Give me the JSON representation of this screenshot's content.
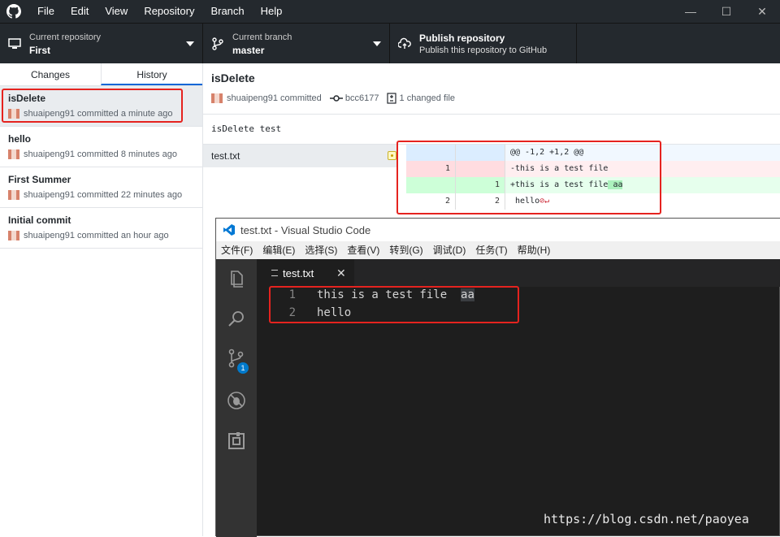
{
  "titlebar": {
    "menu": [
      "File",
      "Edit",
      "View",
      "Repository",
      "Branch",
      "Help"
    ]
  },
  "toolbar": {
    "repo": {
      "label": "Current repository",
      "value": "First"
    },
    "branch": {
      "label": "Current branch",
      "value": "master"
    },
    "publish": {
      "label": "Publish repository",
      "value": "Publish this repository to GitHub"
    }
  },
  "sidebar": {
    "tabs": [
      "Changes",
      "History"
    ],
    "commits": [
      {
        "title": "isDelete",
        "meta": "shuaipeng91 committed a minute ago"
      },
      {
        "title": "hello",
        "meta": "shuaipeng91 committed 8 minutes ago"
      },
      {
        "title": "First Summer",
        "meta": "shuaipeng91 committed 22 minutes ago"
      },
      {
        "title": "Initial commit",
        "meta": "shuaipeng91 committed an hour ago"
      }
    ]
  },
  "commit": {
    "title": "isDelete",
    "author": "shuaipeng91 committed",
    "sha": "bcc6177",
    "changed": "1 changed file",
    "description": "isDelete test",
    "file": "test.txt"
  },
  "diff": {
    "hunk": "@@ -1,2 +1,2 @@",
    "lines": [
      {
        "old": "1",
        "new": "",
        "text": "-this is a test file"
      },
      {
        "old": "",
        "new": "1",
        "text_pre": "+this is a test file",
        "text_hl": " aa"
      },
      {
        "old": "2",
        "new": "2",
        "text": " hello"
      }
    ]
  },
  "vscode": {
    "title": "test.txt - Visual Studio Code",
    "menu": [
      "文件(F)",
      "编辑(E)",
      "选择(S)",
      "查看(V)",
      "转到(G)",
      "调试(D)",
      "任务(T)",
      "帮助(H)"
    ],
    "tab": "test.txt",
    "badge": "1",
    "lines": [
      {
        "num": "1",
        "pre": "this is a test file  ",
        "sel": "aa"
      },
      {
        "num": "2",
        "pre": "hello",
        "sel": ""
      }
    ]
  },
  "watermark": "https://blog.csdn.net/paoyea"
}
